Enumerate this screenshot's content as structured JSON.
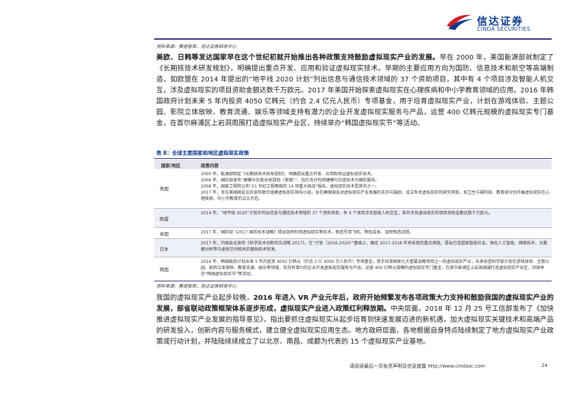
{
  "header": {
    "logo_cn": "信达证券",
    "logo_en": "CINDA SECURITIES",
    "brand_colors": {
      "blue": "#0a3a8c",
      "red": "#d0202a"
    }
  },
  "source_top": "资料来源：赛迪智库，信达证券研发中心",
  "para1": {
    "bold": "美欧、日韩等发达国家早在这个世纪初就开始推出各种政策支持鼓励虚拟现实产业的发展。",
    "rest": "早在 2000 年，美国能源部就制定了《长期核技术研发规划》，明确提出重点开发、应用和验证虚拟现实技术。早期的主要应用方向为国防、信息技术和航空等高端制造，如欧盟在 2014 年提出的“地平线 2020 计划”列出信息与通信技术领域的 37 个资助项目，其中有 4 个项目涉及智能人机交互，涉及虚拟现实的项目资助金额达数千万欧元。2017 年美国开始探索虚拟现实在心理疾病和中小学教育领域的应用。2016 年韩国政府计划未来 5 年内投资 4050 亿韩元（约合 2.4 亿元人民币）专项基金，用于培育虚拟现实产业，计划在游戏体验、主题公园、影院立体放映、教育流通、娱乐等领域支持有潜力的企业开发虚拟现实服务与产品，运营 400 亿韩元规模的虚拟现实专门基金，在首尔麻浦区上岩洞周围打造虚拟现实产业区，持续举办“韩国虚拟现实节”等活动。"
  },
  "table": {
    "title": "表 8：全球主要国家和地区虚拟现实政策",
    "col_country": "国家/地区",
    "col_policy": "政策内容",
    "rows": [
      {
        "country": "美国",
        "items": [
          "2000 年，能源部制定《长期核技术研发规划》，明确提出重点开发、应用和验证虚拟现实技术。",
          "2006 年，国防部发布“建模与仿真总体规划（草案）”，旨在充分利用建模与仿真技术为国防服务。",
          "2008 年，国家工程院公布“21 世纪工程面临的 14 项重大挑战”报告，虚拟现实技术是其中之一。",
          "2017 年，多位美国国会议员宣布联合组建虚拟现实指导小组，旨在确保国会对虚拟现实产业发展的支持与鼓励，设立有关虚拟现实的研究项目，如卫生与福利部、教育部分别开展虚拟现实在心理疾病、中小学教育的试点示范。"
        ]
      },
      {
        "country": "欧盟",
        "items": [
          "2014 年，“地平线 2020”计划中列出信息与通信技术领域的 37 个资助项目，有 4 个项目涉及智能人机交互，其中涉及虚拟现实的项目资助金额达数千万欧元。"
        ]
      },
      {
        "country": "英国",
        "items": [
          "2017 年，国防部《2017 国防技术战略》提出加快利用虚拟现实等技术，制造军用飞机，降低成本、加快制造流程。"
        ]
      },
      {
        "country": "日本",
        "items": [
          "2017 年，内阁会议发布《科学技术创新综合战略 2017》，在“计划（2016-2020）”基础上，确定 2017-2018 年将采取的重点措施，提出打造超级智能社会，强化人工智能、网络技术、大数据分析等与虚拟空间相关的基础技术研发。"
        ]
      },
      {
        "country": "韩国",
        "items": [
          "2016 年，韩国政府计划未来 5 年内投资 4050 亿韩元（约合 2 亿 4000 万人民币）专项基金，用于培育国家九大重要战略项目之一的虚拟现实产业，未来创造科学部计划在游戏体验、主题公园、影院立体放映、教育流通、娱乐等领域，支持有潜力的企业开发虚拟现实服务与产品，运营 400 亿韩元规模的虚拟现实专门基金，在首尔麻浦区上岩洞周围打造虚拟现实产业区，持续举办“韩国虚拟现实节”等活动。"
        ]
      }
    ]
  },
  "source_table": "资料来源：赛迪智库，信达证券研发中心",
  "para2": {
    "part1": "我国的虚拟现实产业起步较晚，",
    "bold1": "2016 年进入 VR 产业元年后，政府开始频繁发布各项政策大力支持和鼓励我国的虚拟现实产业的发展，部省联动政策框架体系逐步形成，虚拟现实产业进入政策红利释放期。",
    "rest": "中央层面，2018 年 12 月 25 号工信部发布了《加快推进虚拟现实产业发展的指导意见》，指出要抓住虚拟现实从起步培育到快速发展迈进的新机遇，加大虚拟现实关键技术和高端产品的研发投入，创新内容与服务模式，建立健全虚拟现实应用生态。地方政府层面，各地根据自身特点陆续制定了地方虚拟现实产业政策或行动计划，并陆陆续续成立了以北京、南昌、成都为代表的 15 个虚拟现实产业基地。"
  },
  "footer": {
    "text": "请阅读最后一页免责声明及信息披露 http://www.cindasc.com",
    "page": "24"
  }
}
